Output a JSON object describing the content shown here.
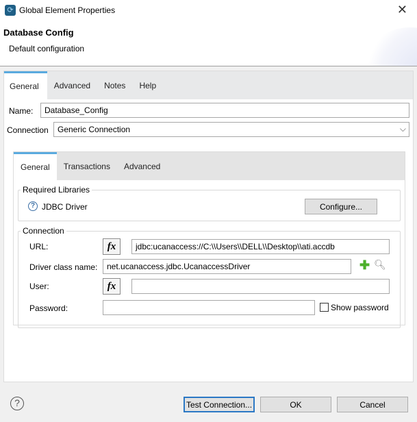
{
  "window": {
    "title": "Global Element Properties"
  },
  "header": {
    "title": "Database Config",
    "subtitle": "Default configuration"
  },
  "tabs": [
    "General",
    "Advanced",
    "Notes",
    "Help"
  ],
  "form": {
    "name_label": "Name:",
    "name_value": "Database_Config",
    "connection_label": "Connection",
    "connection_value": "Generic Connection"
  },
  "inner_tabs": [
    "General",
    "Transactions",
    "Advanced"
  ],
  "required_libraries": {
    "title": "Required Libraries",
    "driver_label": "JDBC Driver",
    "configure_button": "Configure..."
  },
  "connection": {
    "title": "Connection",
    "url_label": "URL:",
    "url_value": "jdbc:ucanaccess://C:\\\\Users\\\\DELL\\\\Desktop\\\\ati.accdb",
    "driver_label": "Driver class name:",
    "driver_value": "net.ucanaccess.jdbc.UcanaccessDriver",
    "user_label": "User:",
    "user_value": "",
    "password_label": "Password:",
    "password_value": "",
    "show_password_label": "Show password",
    "fx_label": "fx"
  },
  "footer": {
    "test_button": "Test Connection...",
    "ok_button": "OK",
    "cancel_button": "Cancel"
  }
}
